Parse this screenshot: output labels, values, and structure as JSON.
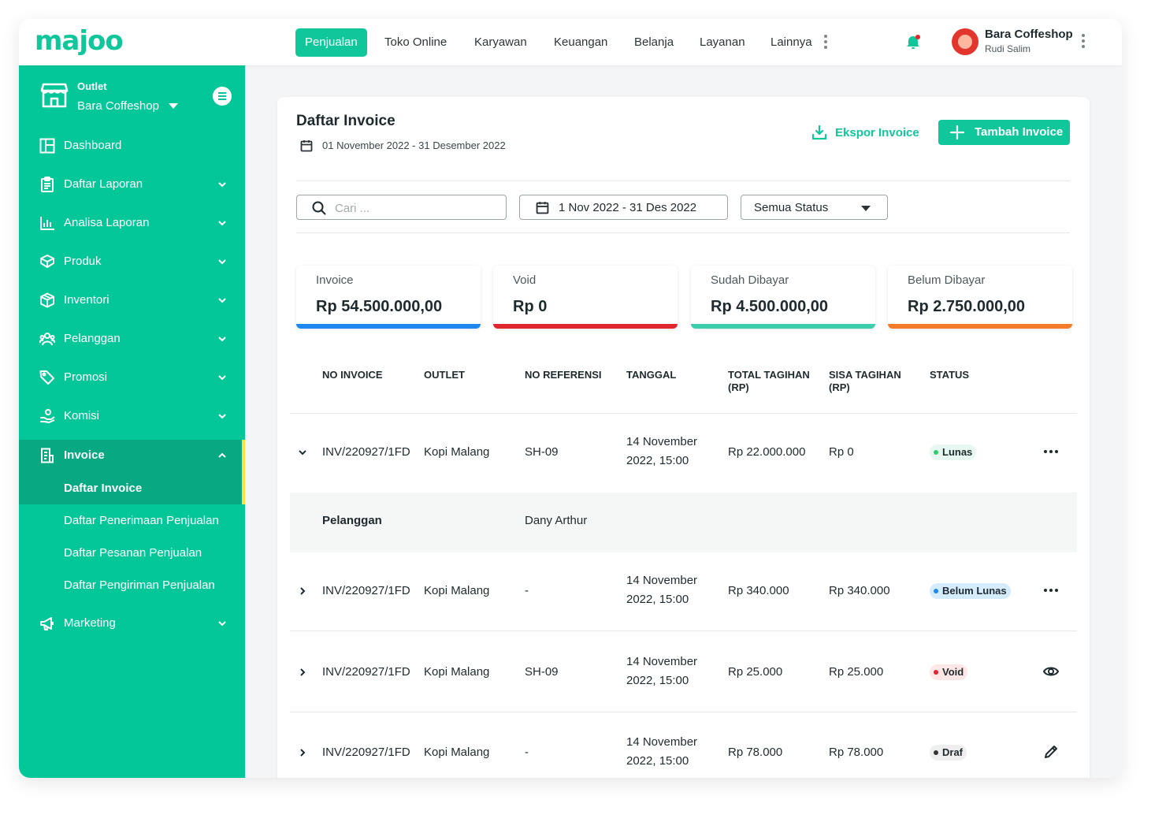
{
  "brand": {
    "logo_text": "majoo",
    "color": "#10c79b"
  },
  "topnav": {
    "tabs": [
      "Penjualan",
      "Toko Online",
      "Karyawan",
      "Keuangan",
      "Belanja",
      "Layanan",
      "Lainnya"
    ],
    "active": "Penjualan",
    "user_name": "Bara Coffeshop",
    "user_sub": "Rudi Salim",
    "notification_icon": "bell-icon"
  },
  "sidebar": {
    "outlet_label": "Outlet",
    "outlet_name": "Bara Coffeshop",
    "items": [
      "Dashboard",
      "Daftar Laporan",
      "Analisa Laporan",
      "Produk",
      "Inventori",
      "Pelanggan",
      "Promosi",
      "Komisi",
      "Invoice",
      "Marketing"
    ],
    "subitems": [
      "Daftar Invoice",
      "Daftar Penerimaan Penjualan",
      "Daftar Pesanan Penjualan",
      "Daftar Pengiriman Penjualan"
    ],
    "active_item": "Invoice",
    "active_subitem": "Daftar Invoice"
  },
  "page": {
    "title": "Daftar Invoice",
    "date_range": "01 November 2022 - 31 Desember 2022",
    "export_label": "Ekspor Invoice",
    "add_label": "Tambah Invoice"
  },
  "filters": {
    "search_placeholder": "Cari ...",
    "date_range": "1 Nov 2022 - 31 Des 2022",
    "status": "Semua Status"
  },
  "stats": [
    {
      "label": "Invoice",
      "value": "Rp 54.500.000,00",
      "color": "#1e88f0"
    },
    {
      "label": "Void",
      "value": "Rp 0",
      "color": "#e0262f"
    },
    {
      "label": "Sudah Dibayar",
      "value": "Rp 4.500.000,00",
      "color": "#3ccdac"
    },
    {
      "label": "Belum Dibayar",
      "value": "Rp 2.750.000,00",
      "color": "#f47b29"
    }
  ],
  "table": {
    "headers": [
      "NO INVOICE",
      "OUTLET",
      "NO REFERENSI",
      "TANGGAL",
      "TOTAL TAGIHAN",
      "(RP)",
      "SISA TAGIHAN",
      "(RP)",
      "STATUS"
    ],
    "rows": [
      {
        "no_invoice": "INV/220927/1FD",
        "outlet": "Kopi Malang",
        "no_ref": "SH-09",
        "date_line1": "14 November",
        "date_line2": "2022, 15:00",
        "total": "Rp 22.000.000",
        "sisa": "Rp 0",
        "status": "Lunas",
        "status_bg": "#e6f8f0",
        "status_dot": "#2ecc71",
        "action_icon": "more-icon",
        "expanded": true
      },
      {
        "no_invoice": "INV/220927/1FD",
        "outlet": "Kopi Malang",
        "no_ref": "-",
        "date_line1": "14 November",
        "date_line2": "2022, 15:00",
        "total": "Rp 340.000",
        "sisa": "Rp 340.000",
        "status": "Belum Lunas",
        "status_bg": "#d4ecfd",
        "status_dot": "#1e88f0",
        "action_icon": "more-icon",
        "expanded": false
      },
      {
        "no_invoice": "INV/220927/1FD",
        "outlet": "Kopi Malang",
        "no_ref": "SH-09",
        "date_line1": "14 November",
        "date_line2": "2022, 15:00",
        "total": "Rp 25.000",
        "sisa": "Rp 25.000",
        "status": "Void",
        "status_bg": "#fde6e6",
        "status_dot": "#e0262f",
        "action_icon": "eye-icon",
        "expanded": false
      },
      {
        "no_invoice": "INV/220927/1FD",
        "outlet": "Kopi Malang",
        "no_ref": "-",
        "date_line1": "14 November",
        "date_line2": "2022, 15:00",
        "total": "Rp 78.000",
        "sisa": "Rp 78.000",
        "status": "Draf",
        "status_bg": "#eeeeee",
        "status_dot": "#333333",
        "action_icon": "pencil-icon",
        "expanded": false
      }
    ],
    "expanded_detail": {
      "label": "Pelanggan",
      "value": "Dany Arthur"
    }
  }
}
